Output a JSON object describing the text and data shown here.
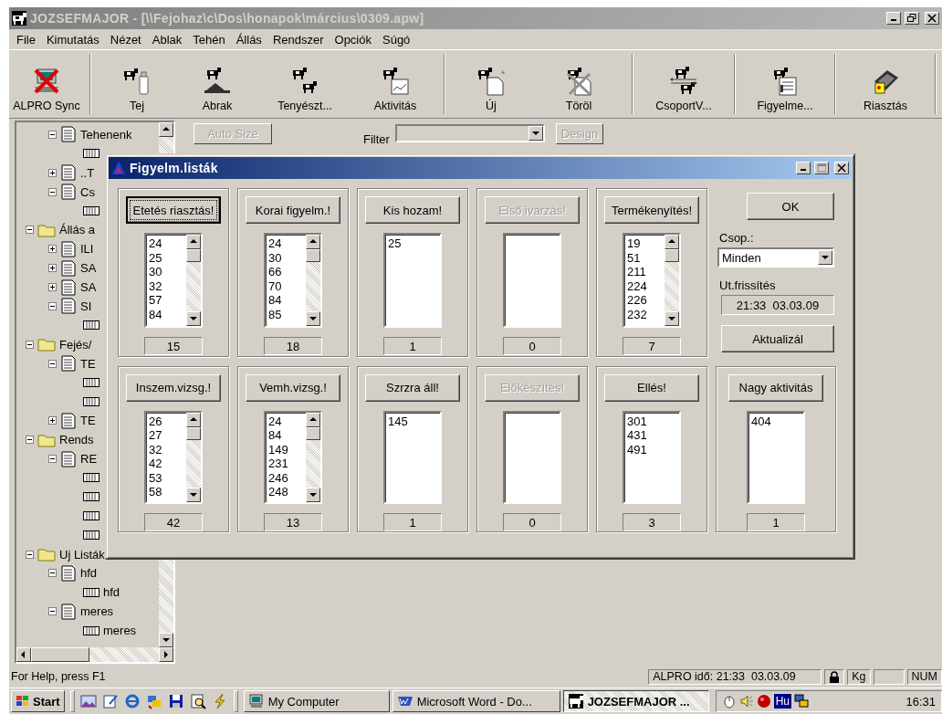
{
  "window": {
    "title": "JOZSEFMAJOR - [\\\\Fejohaz\\c\\Dos\\honapok\\március\\0309.apw]",
    "active": false
  },
  "menu": [
    "File",
    "Kimutatás",
    "Nézet",
    "Ablak",
    "Tehén",
    "Állás",
    "Rendszer",
    "Opciók",
    "Súgó"
  ],
  "toolbar": [
    {
      "label": "ALPRO Sync"
    },
    {
      "label": "Tej"
    },
    {
      "label": "Abrak"
    },
    {
      "label": "Tenyészt..."
    },
    {
      "label": "Aktivitás"
    },
    {
      "label": "Új"
    },
    {
      "label": "Töröl"
    },
    {
      "label": "CsoportV..."
    },
    {
      "label": "Figyelme..."
    },
    {
      "label": "Riasztás"
    }
  ],
  "tree": {
    "continued": [
      {
        "kind": "document",
        "label": "Tehenenk",
        "expanded": true,
        "children": [
          {
            "kind": "table"
          }
        ]
      },
      {
        "kind": "document",
        "label": "..T",
        "expanded": false
      },
      {
        "kind": "document",
        "label": "Cs",
        "expanded": true,
        "children": [
          {
            "kind": "table"
          }
        ]
      }
    ],
    "items": [
      {
        "kind": "folder",
        "label": "Állás a",
        "expanded": true,
        "children": [
          {
            "kind": "document",
            "label": "ILI",
            "expanded": false
          },
          {
            "kind": "document",
            "label": "SA",
            "expanded": false
          },
          {
            "kind": "document",
            "label": "SA",
            "expanded": false
          },
          {
            "kind": "document",
            "label": "SI",
            "expanded": true,
            "children": [
              {
                "kind": "table"
              }
            ]
          }
        ]
      },
      {
        "kind": "folder",
        "label": "Fejés/",
        "expanded": true,
        "children": [
          {
            "kind": "document",
            "label": "TE",
            "expanded": true,
            "children": [
              {
                "kind": "table"
              },
              {
                "kind": "table"
              }
            ]
          },
          {
            "kind": "document",
            "label": "TE",
            "expanded": false
          }
        ]
      },
      {
        "kind": "folder",
        "label": "Rends",
        "expanded": true,
        "children": [
          {
            "kind": "document",
            "label": "RE",
            "expanded": true,
            "children": [
              {
                "kind": "table"
              },
              {
                "kind": "table"
              },
              {
                "kind": "table"
              },
              {
                "kind": "table"
              }
            ]
          }
        ]
      },
      {
        "kind": "folder",
        "label": "Uj Listák",
        "expanded": true,
        "children": [
          {
            "kind": "document",
            "label": "hfd",
            "expanded": true,
            "children": [
              {
                "kind": "table",
                "label": "hfd"
              }
            ]
          },
          {
            "kind": "document",
            "label": "meres",
            "expanded": true,
            "children": [
              {
                "kind": "table",
                "label": "meres"
              }
            ]
          }
        ]
      }
    ]
  },
  "view_toolbar": {
    "auto_size": {
      "label": "Auto Size",
      "disabled": true
    },
    "filter_label": "Filter",
    "design": {
      "label": "Design",
      "disabled": true
    }
  },
  "dialog": {
    "title": "Figyelm.listák",
    "active": true,
    "lists": [
      {
        "button": "Etetés riasztás!",
        "disabled": false,
        "focused": true,
        "scrollable": true,
        "items": [
          "24",
          "25",
          "30",
          "32",
          "57",
          "84"
        ],
        "count": "15"
      },
      {
        "button": "Korai figyelm.!",
        "disabled": false,
        "focused": false,
        "scrollable": true,
        "items": [
          "24",
          "30",
          "66",
          "70",
          "84",
          "85"
        ],
        "count": "18"
      },
      {
        "button": "Kis hozam!",
        "disabled": false,
        "focused": false,
        "scrollable": false,
        "items": [
          "25"
        ],
        "count": "1"
      },
      {
        "button": "Első ivarzás!",
        "disabled": true,
        "focused": false,
        "scrollable": false,
        "count": "0"
      },
      {
        "button": "Termékenyítés!",
        "disabled": false,
        "focused": false,
        "scrollable": true,
        "items": [
          "19",
          "51",
          "211",
          "224",
          "226",
          "232"
        ],
        "count": "7"
      },
      {
        "button": "Inszem.vizsg.!",
        "disabled": false,
        "focused": false,
        "scrollable": true,
        "items": [
          "26",
          "27",
          "32",
          "42",
          "53",
          "58"
        ],
        "count": "42"
      },
      {
        "button": "Vemh.vizsg.!",
        "disabled": false,
        "focused": false,
        "scrollable": true,
        "items": [
          "24",
          "84",
          "149",
          "231",
          "246",
          "248"
        ],
        "count": "13"
      },
      {
        "button": "Szrzra áll!",
        "disabled": false,
        "focused": false,
        "scrollable": false,
        "items": [
          "145"
        ],
        "count": "1"
      },
      {
        "button": "Előkészítés!",
        "disabled": true,
        "focused": false,
        "scrollable": false,
        "count": "0"
      },
      {
        "button": "Ellés!",
        "disabled": false,
        "focused": false,
        "scrollable": false,
        "items": [
          "301",
          "431",
          "491"
        ],
        "count": "3"
      },
      {
        "button": "Nagy aktivitás",
        "disabled": false,
        "focused": false,
        "scrollable": false,
        "items": [
          "404"
        ],
        "count": "1"
      }
    ],
    "ok": "OK",
    "group_label": "Csop.:",
    "group_value": "Minden",
    "refresh_label": "Ut.frissítés",
    "refresh_value": "21:33  03.03.09",
    "update": "Aktualizál"
  },
  "status_bar": {
    "help": "For Help, press F1",
    "time": "ALPRO idő: 21:33  03.03.09",
    "unit": "Kg",
    "num": "NUM"
  },
  "taskbar": {
    "start": "Start",
    "tasks": [
      {
        "label": "My Computer",
        "selected": false
      },
      {
        "label": "Microsoft Word - Do...",
        "selected": false
      },
      {
        "label": "JOZSEFMAJOR ...",
        "selected": true
      }
    ],
    "language": "Hu",
    "clock": "16:31"
  }
}
